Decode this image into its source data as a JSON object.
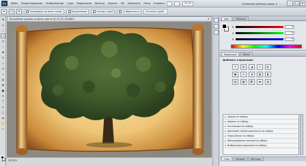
{
  "app": {
    "logo": "Ps",
    "workspace_label": "Основные рабочая среда",
    "zoom": "33,3%"
  },
  "menu": [
    "Файл",
    "Редактирование",
    "Изображение",
    "Слои",
    "Выделение",
    "Фильтр",
    "Анализ",
    "3D",
    "Просмотр",
    "Окно",
    "Справка"
  ],
  "options_bar": {
    "chk1": "Тонировать по всем слоям",
    "chk2": "Загрязнение",
    "chk3": "Усилить край",
    "chk4": "Стабильность",
    "btn": "Уточнить край..."
  },
  "document": {
    "tab_title": "Волшебное дерево на фоне свитка @ 33,3% (RGB/8*)",
    "close": "×",
    "status": "33,33%"
  },
  "panels": {
    "color_tabs": [
      "Цвет",
      "Образцы"
    ],
    "sliders": [
      {
        "label": "R",
        "value": "0"
      },
      {
        "label": "G",
        "value": "0"
      },
      {
        "label": "B",
        "value": "0"
      }
    ],
    "adj_tabs": [
      "Коррекция",
      "Маски"
    ],
    "adj_title": "Добавить коррекцию",
    "adj_icons_row1": [
      "☀",
      "▤",
      "◢",
      "±",
      "◐"
    ],
    "adj_icons_row2": [
      "▣",
      "⚖",
      "◑",
      "▦",
      "◧"
    ],
    "adj_icons_row3": [
      "▨",
      "▩",
      "◩",
      "▬",
      "▧"
    ],
    "presets": [
      "Уровни по набору",
      "Кривые по набору",
      "Экспозиция по набору",
      "Цветовой тон/Насыщенность по набору",
      "Черно-белое по набору",
      "Микширование каналов по набору",
      "Выборочная коррекция по набору"
    ],
    "bottom_tabs": [
      "Слои",
      "Каналы",
      "Контуры"
    ]
  }
}
